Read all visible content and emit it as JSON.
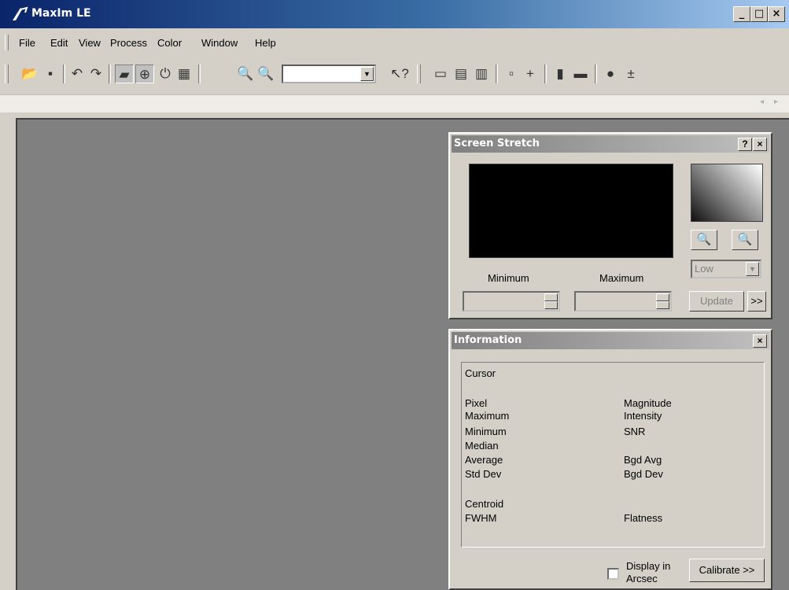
{
  "window": {
    "title": "MaxIm LE",
    "minimize": "_",
    "maximize": "□",
    "close": "×"
  },
  "menu": [
    "File",
    "Edit",
    "View",
    "Process",
    "Color",
    "Window",
    "Help"
  ],
  "toolbar": {
    "icons": [
      "open-folder-icon",
      "save-icon",
      "undo-icon",
      "redo-icon",
      "screen-stretch-icon",
      "information-icon",
      "split-icon",
      "properties-icon",
      "zoom-in-icon",
      "zoom-out-icon",
      "context-help-icon",
      "ruler-icon",
      "overlay-icon",
      "report-icon",
      "copy-icon",
      "crosshair-icon",
      "histogram-icon",
      "strip-icon",
      "star-icon",
      "plusminus-icon"
    ],
    "zoom_value": ""
  },
  "screen_stretch": {
    "title": "Screen Stretch",
    "help": "?",
    "close": "×",
    "min_label": "Minimum",
    "max_label": "Maximum",
    "min_value": "",
    "max_value": "",
    "mode": "Low",
    "update_label": "Update",
    "expand_label": ">>"
  },
  "information": {
    "title": "Information",
    "close": "×",
    "cursor_label": "Cursor",
    "left_labels": [
      "Pixel",
      "Maximum",
      "Minimum",
      "Median",
      "Average",
      "Std Dev"
    ],
    "right_labels": [
      "Magnitude",
      "Intensity",
      "SNR",
      "",
      "Bgd Avg",
      "Bgd Dev"
    ],
    "centroid_label": "Centroid",
    "fwhm_label": "FWHM",
    "flatness_label": "Flatness",
    "arcsec_label_1": "Display in",
    "arcsec_label_2": "Arcsec",
    "calibrate_label": "Calibrate >>"
  }
}
